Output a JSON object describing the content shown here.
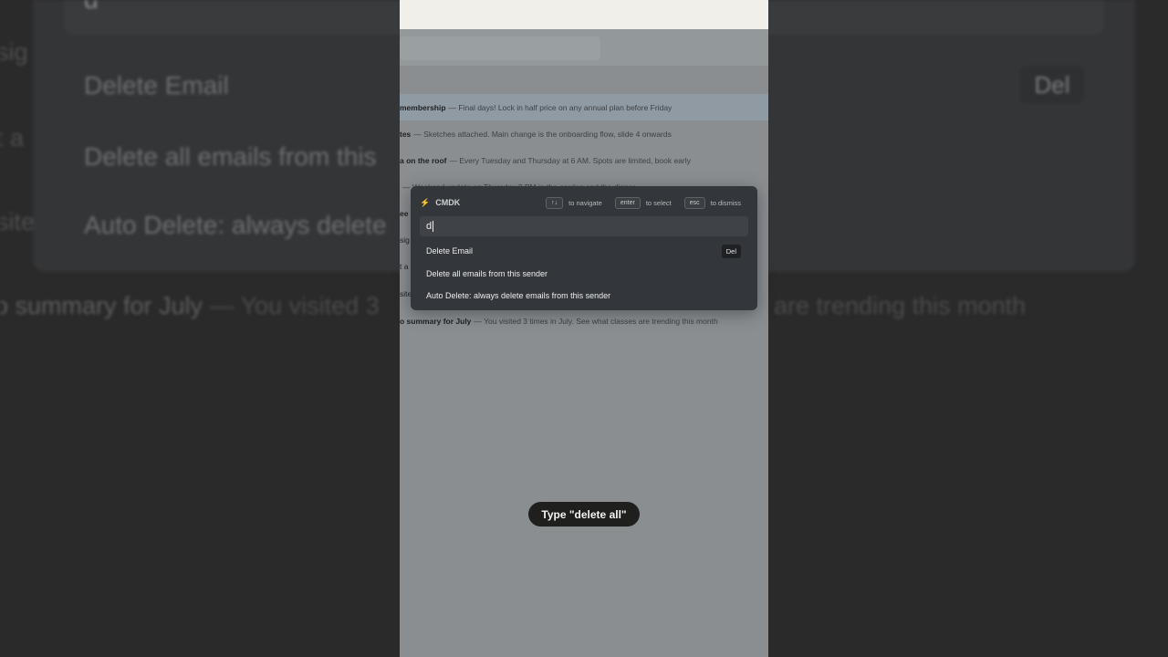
{
  "background": {
    "search_query": "d",
    "items": [
      {
        "label": "Delete Email",
        "badge": "Del"
      },
      {
        "label": "Delete all emails from this"
      },
      {
        "label": "Auto Delete: always delete"
      }
    ],
    "left_fragments": [
      "sig",
      "t a",
      "site"
    ],
    "summary_line": {
      "subject": "o summary for July",
      "preview": "— You visited 3",
      "right_tail": "are trending this month"
    }
  },
  "app": {
    "emails": [
      {
        "subject": "membership",
        "preview": "— Final days! Lock in half price on any annual plan before Friday",
        "highlight": true
      },
      {
        "subject": "tes",
        "preview": "— Sketches attached. Main change is the onboarding flow, slide 4 onwards"
      },
      {
        "subject": "a on the roof",
        "preview": "— Every Tuesday and Thursday at 6 AM. Spots are limited, book early"
      },
      {
        "subject": "",
        "preview": "— Weekend update on Thursday 2 PM in the garden and the dinner"
      },
      {
        "subject": "ee c",
        "preview": ""
      },
      {
        "subject": "sig",
        "preview": ""
      },
      {
        "subject": "t a",
        "preview": ""
      },
      {
        "subject": "site",
        "preview": ""
      },
      {
        "subject": "o summary for July",
        "preview": "— You visited 3 times in July. See what classes are trending this month"
      }
    ]
  },
  "cmdk": {
    "title": "CMDK",
    "hints": [
      {
        "key": "↑↓",
        "label": "to navigate"
      },
      {
        "key": "enter",
        "label": "to select"
      },
      {
        "key": "esc",
        "label": "to dismiss"
      }
    ],
    "query": "d",
    "items": [
      {
        "label": "Delete Email",
        "badge": "Del"
      },
      {
        "label": "Delete all emails from this sender"
      },
      {
        "label": "Auto Delete: always delete emails from this sender"
      }
    ]
  },
  "instruction": "Type \"delete all\""
}
